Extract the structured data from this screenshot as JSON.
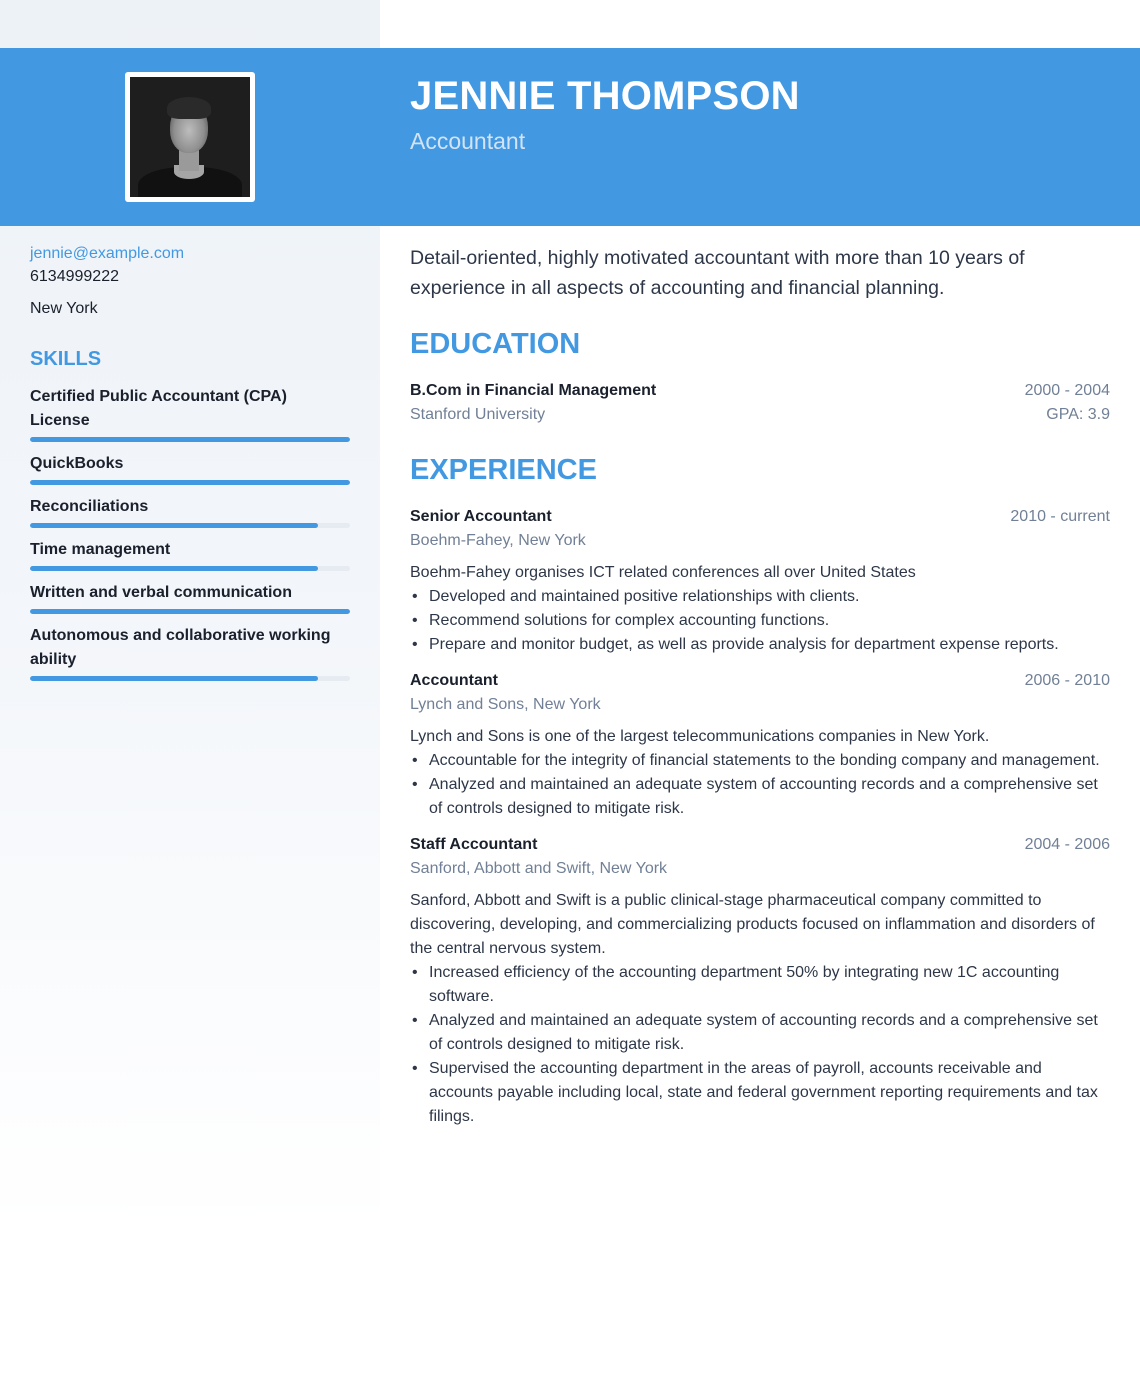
{
  "header": {
    "name": "JENNIE THOMPSON",
    "title": "Accountant",
    "accent_color": "#4299e1"
  },
  "contact": {
    "email": "jennie@example.com",
    "phone": "6134999222",
    "city": "New York"
  },
  "skills": {
    "heading": "SKILLS",
    "items": [
      {
        "name": "Certified Public Accountant (CPA) License",
        "level_percent": 100
      },
      {
        "name": "QuickBooks",
        "level_percent": 100
      },
      {
        "name": "Reconciliations",
        "level_percent": 90
      },
      {
        "name": "Time management",
        "level_percent": 90
      },
      {
        "name": "Written and verbal communication",
        "level_percent": 100
      },
      {
        "name": "Autonomous and collaborative working ability",
        "level_percent": 90
      }
    ]
  },
  "summary": "Detail-oriented, highly motivated accountant with more than 10 years of experience in all aspects of accounting and financial planning.",
  "education": {
    "heading": "EDUCATION",
    "items": [
      {
        "degree": "B.Com in Financial Management",
        "school": "Stanford University",
        "years": "2000 - 2004",
        "gpa": "GPA: 3.9"
      }
    ]
  },
  "experience": {
    "heading": "EXPERIENCE",
    "items": [
      {
        "title": "Senior Accountant",
        "company": "Boehm-Fahey, New York",
        "years": "2010 - current",
        "description": "Boehm-Fahey organises ICT related conferences all over United States",
        "bullets": [
          "Developed and maintained positive relationships with clients.",
          "Recommend solutions for complex accounting functions.",
          "Prepare and monitor budget, as well as provide analysis for department expense reports."
        ]
      },
      {
        "title": "Accountant",
        "company": "Lynch and Sons, New York",
        "years": "2006 - 2010",
        "description": "Lynch and Sons is one of the largest telecommunications companies in New York.",
        "bullets": [
          "Accountable for the integrity of financial statements to the bonding company and management.",
          "Analyzed and maintained an adequate system of accounting records and a comprehensive set of controls designed to mitigate risk."
        ]
      },
      {
        "title": "Staff Accountant",
        "company": "Sanford, Abbott and Swift, New York",
        "years": "2004 - 2006",
        "description": "Sanford, Abbott and Swift is a public clinical-stage pharmaceutical company committed to discovering, developing, and commercializing products focused on inflammation and disorders of the central nervous system.",
        "bullets": [
          "Increased efficiency of the accounting department 50% by integrating new 1C accounting software.",
          "Analyzed and maintained an adequate system of accounting records and a comprehensive set of controls designed to mitigate risk.",
          "Supervised the accounting department in the areas of payroll, accounts receivable and accounts payable including local, state and federal government reporting requirements and tax filings."
        ]
      }
    ]
  },
  "icons": {
    "bullet": "•"
  }
}
